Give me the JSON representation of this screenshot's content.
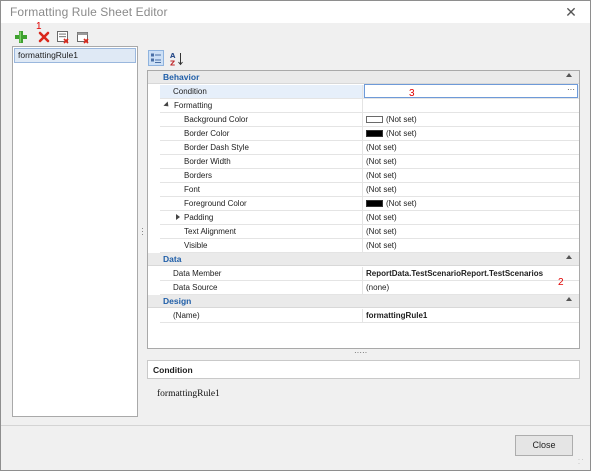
{
  "window": {
    "title": "Formatting Rule Sheet Editor"
  },
  "toolbar": {
    "annotation": "1",
    "add_icon": "plus-green-icon",
    "delete_icon": "delete-red-x-icon",
    "import_icon": "import-rules-icon",
    "purge_icon": "purge-rules-icon"
  },
  "rules": {
    "items": [
      "formattingRule1"
    ]
  },
  "property_toolbar": {
    "categorized_icon": "categorized-icon",
    "alphabetical_icon": "sort-az-icon"
  },
  "grid": {
    "behavior": {
      "label": "Behavior",
      "condition_label": "Condition",
      "condition_value": "",
      "condition_annotation": "3",
      "formatting_label": "Formatting",
      "background_color_label": "Background Color",
      "background_color_value": "(Not set)",
      "border_color_label": "Border Color",
      "border_color_value": "(Not set)",
      "border_dash_style_label": "Border Dash Style",
      "border_dash_style_value": "(Not set)",
      "border_width_label": "Border Width",
      "border_width_value": "(Not set)",
      "borders_label": "Borders",
      "borders_value": "(Not set)",
      "font_label": "Font",
      "font_value": "(Not set)",
      "foreground_color_label": "Foreground Color",
      "foreground_color_value": "(Not set)",
      "padding_label": "Padding",
      "padding_value": "(Not set)",
      "text_alignment_label": "Text Alignment",
      "text_alignment_value": "(Not set)",
      "visible_label": "Visible",
      "visible_value": "(Not set)"
    },
    "data": {
      "label": "Data",
      "data_member_label": "Data Member",
      "data_member_value": "ReportData.TestScenarioReport.TestScenarios",
      "data_member_annotation": "2",
      "data_source_label": "Data Source",
      "data_source_value": "(none)"
    },
    "design": {
      "label": "Design",
      "name_label": "(Name)",
      "name_value": "formattingRule1"
    }
  },
  "description": {
    "title": "Condition",
    "body": "formattingRule1"
  },
  "footer": {
    "close_label": "Close"
  },
  "colors": {
    "category_text": "#1f5ea8",
    "annotation": "#e00000",
    "white_swatch": "#ffffff",
    "black_swatch": "#000000"
  }
}
